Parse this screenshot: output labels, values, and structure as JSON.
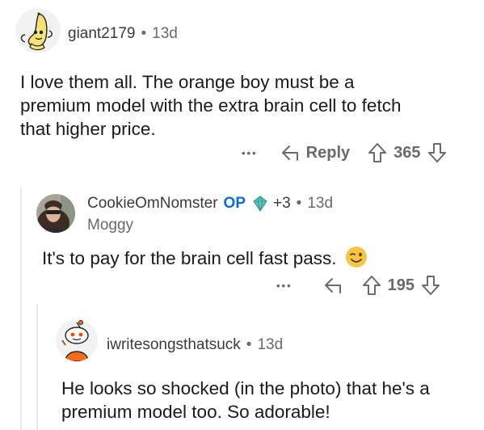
{
  "comments": [
    {
      "author": "giant2179",
      "separator": "•",
      "time": "13d",
      "body": "I love them all. The orange boy must be a premium model with the extra brain cell to fetch that higher price.",
      "reply_label": "Reply",
      "score": "365",
      "more": "•••"
    },
    {
      "author": "CookieOmNomster",
      "op_label": "OP",
      "award_count": "+3",
      "separator": "•",
      "time": "13d",
      "flair": "Moggy",
      "body": "It's to pay for the brain cell fast pass.",
      "score": "195",
      "more": "•••"
    },
    {
      "author": "iwritesongsthatsuck",
      "separator": "•",
      "time": "13d",
      "body": "He looks so shocked (in the photo) that he's a premium model too. So adorable!"
    }
  ],
  "colors": {
    "text": "#1a1a1b",
    "meta": "#6a6a6d",
    "op": "#0a6fcc",
    "thread_line": "#e8e8ea",
    "wink_emoji": "#f6c544"
  },
  "icons": [
    "snoo-avatar-banana",
    "user-photo-avatar",
    "snoo-avatar-orange",
    "reply-arrow-icon",
    "upvote-icon",
    "downvote-icon",
    "award-diamond-icon",
    "wink-emoji-icon"
  ]
}
